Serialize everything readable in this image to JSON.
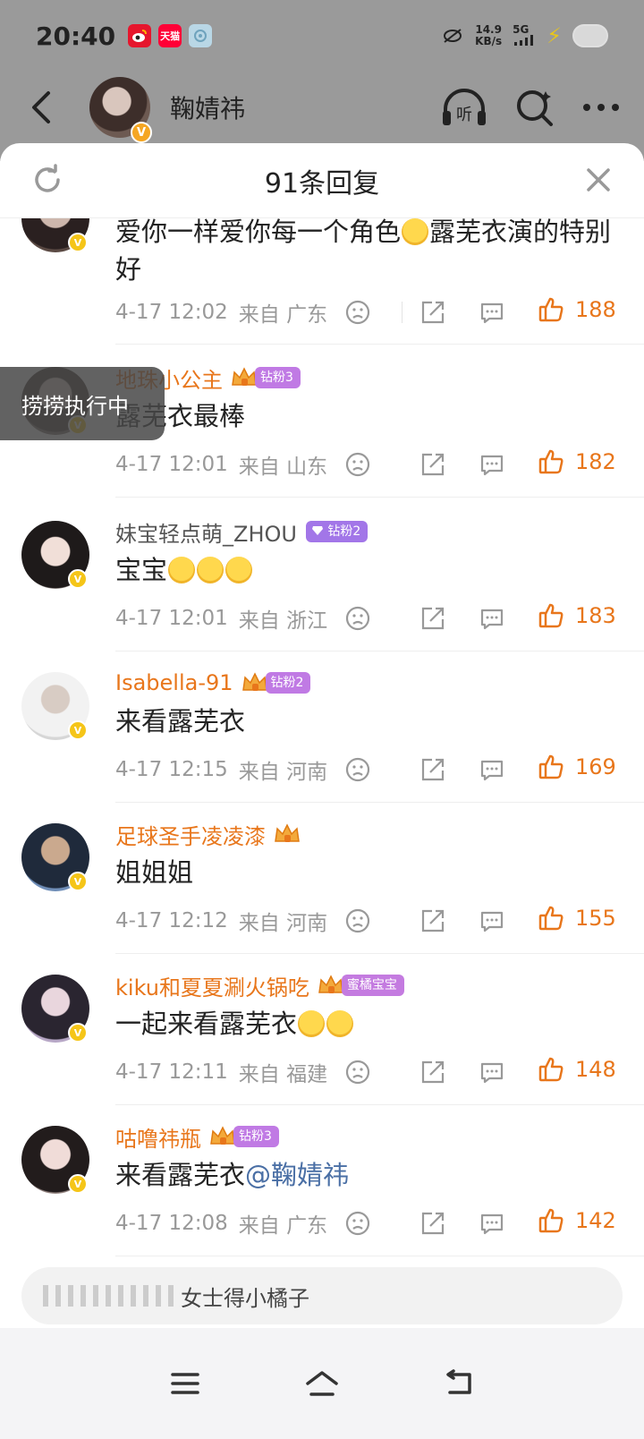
{
  "status_bar": {
    "time": "20:40",
    "apps": [
      {
        "icon": "weibo-icon",
        "color": "#e6162d",
        "label": ""
      },
      {
        "icon": "tmall-icon",
        "color": "#ff0036",
        "label": "天猫"
      },
      {
        "icon": "app-icon",
        "color": "#b9d7e6",
        "label": ""
      }
    ],
    "net_speed_value": "14.9",
    "net_speed_unit": "KB/s",
    "signal": "5G"
  },
  "header": {
    "user_name": "鞠婧祎",
    "verified_badge": "V"
  },
  "panel": {
    "title": "91条回复"
  },
  "toast": {
    "text": "捞捞执行中"
  },
  "comments": [
    {
      "name": "",
      "text_parts": [
        "爱你一样爱你每一个角色",
        "露芜衣演的特别好"
      ],
      "time": "4-17 12:02",
      "location": "来自 广东",
      "likes": "188"
    },
    {
      "name": "地珠小公主",
      "fan_tag": "钻粉3",
      "text": "露芜衣最棒",
      "time": "4-17 12:01",
      "location": "来自 山东",
      "likes": "182"
    },
    {
      "name": "妹宝轻点萌_ZHOU",
      "fan_tag": "钻粉2",
      "text": "宝宝",
      "time": "4-17 12:01",
      "location": "来自 浙江",
      "likes": "183"
    },
    {
      "name": "Isabella-91",
      "fan_tag": "钻粉2",
      "text": "来看露芜衣",
      "time": "4-17 12:15",
      "location": "来自 河南",
      "likes": "169"
    },
    {
      "name": "足球圣手凌凌漆",
      "text": "姐姐姐",
      "time": "4-17 12:12",
      "location": "来自 河南",
      "likes": "155"
    },
    {
      "name": "kiku和夏夏涮火锅吃",
      "fan_tag": "蜜橘宝宝",
      "text": "一起来看露芜衣",
      "time": "4-17 12:11",
      "location": "来自 福建",
      "likes": "148"
    },
    {
      "name": "咕噜祎瓶",
      "fan_tag": "钻粉3",
      "text": "来看露芜衣",
      "mention": "@鞠婧祎",
      "time": "4-17 12:08",
      "location": "来自 广东",
      "likes": "142"
    }
  ],
  "reply_input": {
    "placeholder": "女士得小橘子"
  },
  "colors": {
    "accent": "#e8761b",
    "mention": "#4a6fa5",
    "overlay": "#9a9a9a"
  }
}
